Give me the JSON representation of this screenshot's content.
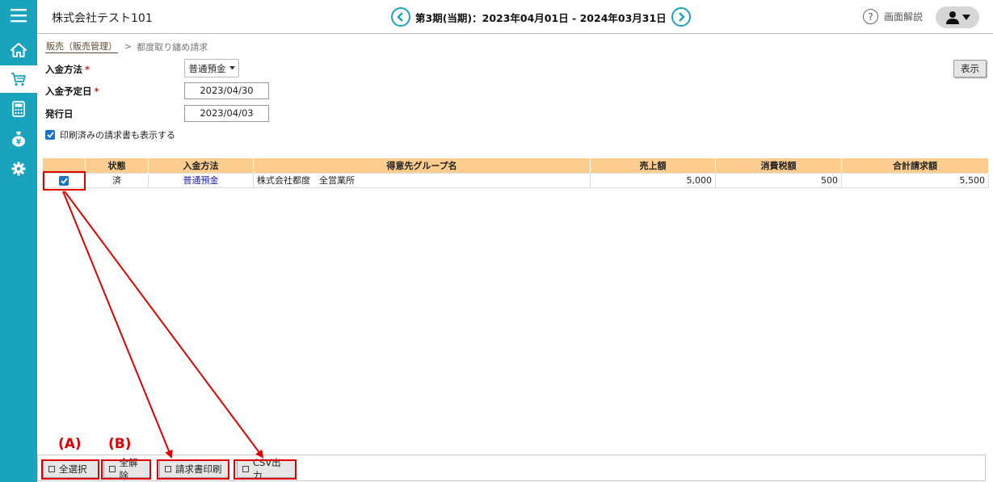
{
  "header": {
    "company": "株式会社テスト101",
    "period": "第3期(当期)：2023年04月01日 - 2024年03月31日",
    "help_label": "画面解説"
  },
  "sidebar": {
    "items": [
      {
        "name": "menu-icon"
      },
      {
        "name": "home-icon"
      },
      {
        "name": "cart-icon",
        "active": true
      },
      {
        "name": "calculator-icon"
      },
      {
        "name": "money-bag-icon"
      },
      {
        "name": "gear-icon"
      }
    ]
  },
  "breadcrumb": {
    "parent": "販売（販売管理）",
    "separator": ">",
    "current": "都度取り纏め請求"
  },
  "form": {
    "payment_method_label": "入金方法",
    "payment_method_value": "普通預金",
    "due_date_label": "入金予定日",
    "due_date_value": "2023/04/30",
    "issue_date_label": "発行日",
    "issue_date_value": "2023/04/03",
    "required_mark": "*",
    "show_printed_label": "印刷済みの請求書も表示する",
    "show_printed_checked": true,
    "show_button": "表示"
  },
  "table": {
    "columns": [
      "",
      "状態",
      "入金方法",
      "得意先グループ名",
      "売上額",
      "消費税額",
      "合計請求額"
    ],
    "rows": [
      {
        "checked": true,
        "status": "済",
        "payment_method": "普通預金",
        "group_name": "株式会社都度　全営業所",
        "sales": "5,000",
        "tax": "500",
        "total": "5,500"
      }
    ]
  },
  "footer": {
    "select_all": "全選択",
    "deselect_all": "全解除",
    "print_invoice": "請求書印刷",
    "csv_export": "CSV出力"
  },
  "annotations": {
    "label_a": "(A)",
    "label_b": "(B)",
    "color": "#e00000"
  },
  "colors": {
    "sidebar": "#1aa3bd",
    "table_header": "#fccd8e",
    "link": "#1a1ab8"
  }
}
